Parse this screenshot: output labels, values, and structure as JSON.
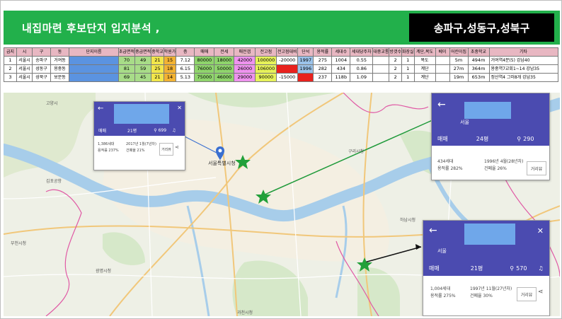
{
  "header": {
    "title": "내집마련 후보단지 입지분석 ,",
    "region": "송파구,성동구,성북구"
  },
  "table": {
    "columns": [
      "급지",
      "시",
      "구",
      "동",
      "단지이름",
      "초급면적",
      "중급면적",
      "중학교",
      "학원가",
      "층",
      "매매",
      "전세",
      "매전갭",
      "전고점",
      "전고점대비",
      "단석",
      "용적률",
      "세대수",
      "세대당주차",
      "대중교통",
      "방갯수",
      "화장실",
      "계단,복도",
      "베이",
      "어린이집",
      "초중학교",
      "기타"
    ],
    "rows": [
      [
        "1",
        "서울시",
        "송파구",
        "거여동",
        "",
        "70",
        "49",
        "21",
        "15",
        "7.12",
        "80000",
        "18000",
        "42000",
        "100000",
        "-20000",
        "1997",
        "275",
        "1004",
        "0.55",
        "",
        "2",
        "1",
        "복도",
        "",
        "5m",
        "494m",
        "거여역4분(5) 강남40"
      ],
      [
        "2",
        "서울시",
        "성동구",
        "용중동",
        "",
        "81",
        "59",
        "25",
        "18",
        "6.15",
        "76000",
        "50000",
        "26000",
        "106000",
        "",
        "1996",
        "282",
        "434",
        "0.86",
        "",
        "2",
        "1",
        "계단",
        "",
        "27m",
        "364m",
        "용중역7교회1~14 강남35"
      ],
      [
        "3",
        "서울시",
        "성북구",
        "보문동",
        "",
        "69",
        "45",
        "21",
        "14",
        "5.13",
        "75000",
        "46000",
        "29000",
        "90000",
        "-15000",
        "",
        "237",
        "118b",
        "1.09",
        "",
        "2",
        "1",
        "계단",
        "",
        "19m",
        "653m",
        "정산역4 그러8개 강남35"
      ]
    ]
  },
  "map": {
    "labels": {
      "center": "서울특별시청",
      "guri": "구리시청",
      "gwangmyeong": "광명시청",
      "bucheon": "부천시청",
      "gwacheon": "과천시청",
      "hanam": "하남시청",
      "ilsan": "고양시",
      "gimpo": "김포공항"
    }
  },
  "cards": [
    {
      "trade": "매매",
      "size": "21평",
      "views": "699",
      "households": "1,386세대",
      "far": "용적률 237%",
      "built": "2017년 1월(7년차)",
      "ratio": "건폐율 21%",
      "button": "거리뷰"
    },
    {
      "sub": "서울",
      "trade": "매매",
      "size": "24평",
      "views": "290",
      "households": "434세대",
      "far": "용적률 282%",
      "built": "1996년 4월(28년차)",
      "ratio": "건폐율 26%",
      "button": "거리뷰"
    },
    {
      "sub": "서울",
      "trade": "매매",
      "size": "21평",
      "views": "570",
      "households": "1,004세대",
      "far": "용적률 275%",
      "built": "1997년 11월(27년차)",
      "ratio": "건폐율 30%",
      "button": "거리뷰"
    }
  ],
  "colors": {
    "header": "#22b04b",
    "card_bar": "#4b4bb0",
    "marker": "#22a03a",
    "river": "#a7cdea"
  }
}
